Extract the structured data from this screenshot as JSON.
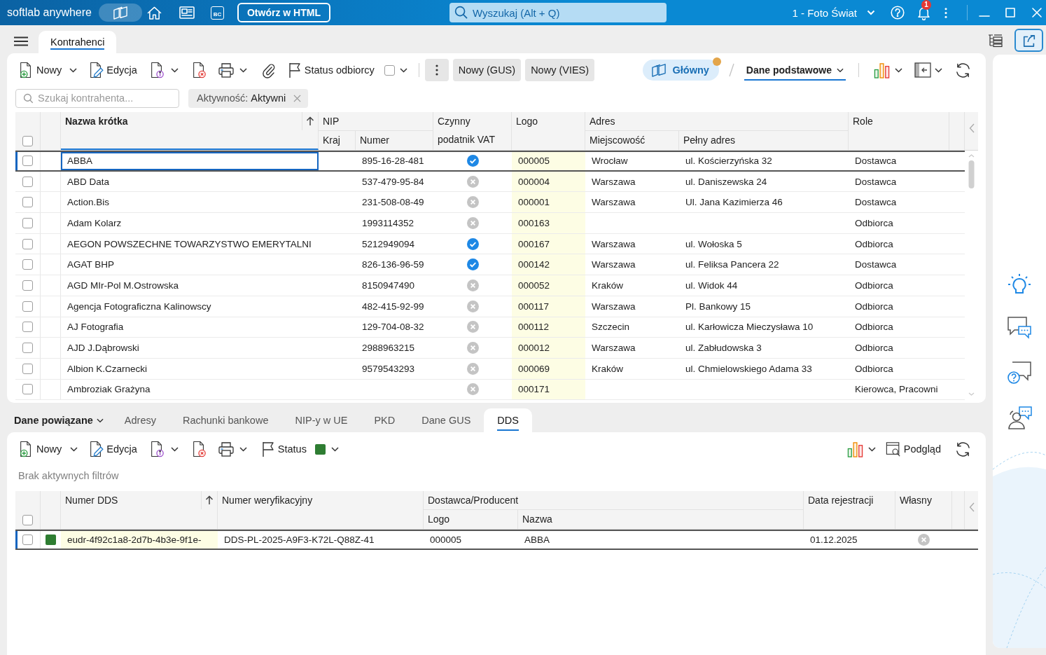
{
  "title_bar": {
    "brand": "softlab anywhere",
    "bc_label": "BC",
    "open_html_button": "Otwórz w HTML",
    "search": {
      "placeholder": "Wyszukaj (Alt + Q)"
    },
    "company": "1 - Foto Świat",
    "notification_count": "1"
  },
  "tabs": [
    {
      "label": "Kontrahenci",
      "selected": true
    }
  ],
  "toolbar": {
    "new": "Nowy",
    "edit": "Edycja",
    "status": "Status odbiorcy",
    "status_checked": false,
    "gus_button": "Nowy (GUS)",
    "vies_button": "Nowy (VIES)",
    "view": {
      "label": "Główny",
      "changed": true
    },
    "layout": "Dane podstawowe"
  },
  "filters": {
    "search": {
      "placeholder": "Szukaj kontrahenta..."
    },
    "chips": [
      {
        "name": "Aktywność:",
        "value": "Aktywni"
      }
    ]
  },
  "table": {
    "all_checked": false,
    "columns": [
      {
        "label": "Nazwa krótka",
        "sorted": true,
        "focused": true
      },
      {
        "label": "NIP",
        "children": [
          {
            "label": "Kraj"
          },
          {
            "label": "Numer"
          }
        ]
      },
      {
        "label": "Czynny podatnik VAT"
      },
      {
        "label": "Logo",
        "highlighted": true
      },
      {
        "label": "Adres",
        "children": [
          {
            "label": "Miejscowość"
          },
          {
            "label": "Pełny adres"
          }
        ]
      },
      {
        "label": "Role"
      }
    ],
    "rows": [
      {
        "checked": false,
        "selected": true,
        "name": "ABBA",
        "nip": "895-16-28-481",
        "vat_active": true,
        "logo": "000005",
        "city": "Wrocław",
        "address": "ul. Kościerzyńska 32",
        "roles": "Dostawca"
      },
      {
        "checked": false,
        "selected": false,
        "name": "ABD Data",
        "nip": "537-479-95-84",
        "vat_active": false,
        "logo": "000004",
        "city": "Warszawa",
        "address": "ul. Daniszewska 24",
        "roles": "Dostawca"
      },
      {
        "checked": false,
        "selected": false,
        "name": "Action.Bis",
        "nip": "231-508-08-49",
        "vat_active": false,
        "logo": "000001",
        "city": "Warszawa",
        "address": "Ul. Jana Kazimierza 46",
        "roles": "Dostawca"
      },
      {
        "checked": false,
        "selected": false,
        "name": "Adam Kolarz",
        "nip": "1993114352",
        "vat_active": false,
        "logo": "000163",
        "roles": "Odbiorca"
      },
      {
        "checked": false,
        "selected": false,
        "name": "AEGON POWSZECHNE TOWARZYSTWO EMERYTALNI",
        "nip": "5212949094",
        "vat_active": true,
        "logo": "000167",
        "city": "Warszawa",
        "address": "ul. Wołoska 5",
        "roles": "Odbiorca"
      },
      {
        "checked": false,
        "selected": false,
        "name": "AGAT BHP",
        "nip": "826-136-96-59",
        "vat_active": true,
        "logo": "000142",
        "city": "Warszawa",
        "address": "ul. Feliksa Pancera 22",
        "roles": "Dostawca"
      },
      {
        "checked": false,
        "selected": false,
        "name": "AGD MIr-Pol M.Ostrowska",
        "nip": "8150947490",
        "vat_active": false,
        "logo": "000052",
        "city": "Kraków",
        "address": "ul. Widok 44",
        "roles": "Odbiorca"
      },
      {
        "checked": false,
        "selected": false,
        "name": "Agencja Fotograficzna Kalinowscy",
        "nip": "482-415-92-99",
        "vat_active": false,
        "logo": "000117",
        "city": "Warszawa",
        "address": "Pl. Bankowy 15",
        "roles": "Odbiorca"
      },
      {
        "checked": false,
        "selected": false,
        "name": "AJ Fotografia",
        "nip": "129-704-08-32",
        "vat_active": false,
        "logo": "000112",
        "city": "Szczecin",
        "address": "ul. Karłowicza Mieczysława 10",
        "roles": "Odbiorca"
      },
      {
        "checked": false,
        "selected": false,
        "name": "AJD J.Dąbrowski",
        "nip": "2988963215",
        "vat_active": false,
        "logo": "000012",
        "city": "Warszawa",
        "address": "ul. Zabłudowska 3",
        "roles": "Odbiorca"
      },
      {
        "checked": false,
        "selected": false,
        "name": "Albion K.Czarnecki",
        "nip": "9579543293",
        "vat_active": false,
        "logo": "000069",
        "city": "Kraków",
        "address": "ul. Chmielowskiego Adama 33",
        "roles": "Odbiorca"
      },
      {
        "checked": false,
        "selected": false,
        "name": "Ambroziak Grażyna",
        "vat_active": false,
        "logo": "000171",
        "roles": "Kierowca, Pracowni"
      }
    ]
  },
  "related": {
    "title": "Dane powiązane",
    "tabs": [
      {
        "label": "Adresy",
        "selected": false
      },
      {
        "label": "Rachunki bankowe",
        "selected": false
      },
      {
        "label": "NIP-y w UE",
        "selected": false
      },
      {
        "label": "PKD",
        "selected": false
      },
      {
        "label": "Dane GUS",
        "selected": false
      },
      {
        "label": "DDS",
        "selected": true
      }
    ],
    "toolbar": {
      "new": "Nowy",
      "edit": "Edycja",
      "status": {
        "label": "Status",
        "color": "#2e7d32"
      },
      "preview": "Podgląd"
    },
    "filter_note": "Brak aktywnych filtrów",
    "table": {
      "all_checked": false,
      "columns": [
        {
          "label": "Numer DDS",
          "sorted": true,
          "highlighted": true
        },
        {
          "label": "Numer weryfikacyjny"
        },
        {
          "label": "Dostawca/Producent",
          "children": [
            {
              "label": "Logo"
            },
            {
              "label": "Nazwa"
            }
          ]
        },
        {
          "label": "Data rejestracji"
        },
        {
          "label": "Własny"
        }
      ],
      "rows": [
        {
          "checked": false,
          "selected": true,
          "color": "#2e7d32",
          "number": "eudr-4f92c1a8-2d7b-4b3e-9f1e-",
          "verification": "DDS-PL-2025-A9F3-K72L-Q88Z-41",
          "logo": "000005",
          "name": "ABBA",
          "registered": "01.12.2025",
          "own": false
        }
      ]
    }
  }
}
